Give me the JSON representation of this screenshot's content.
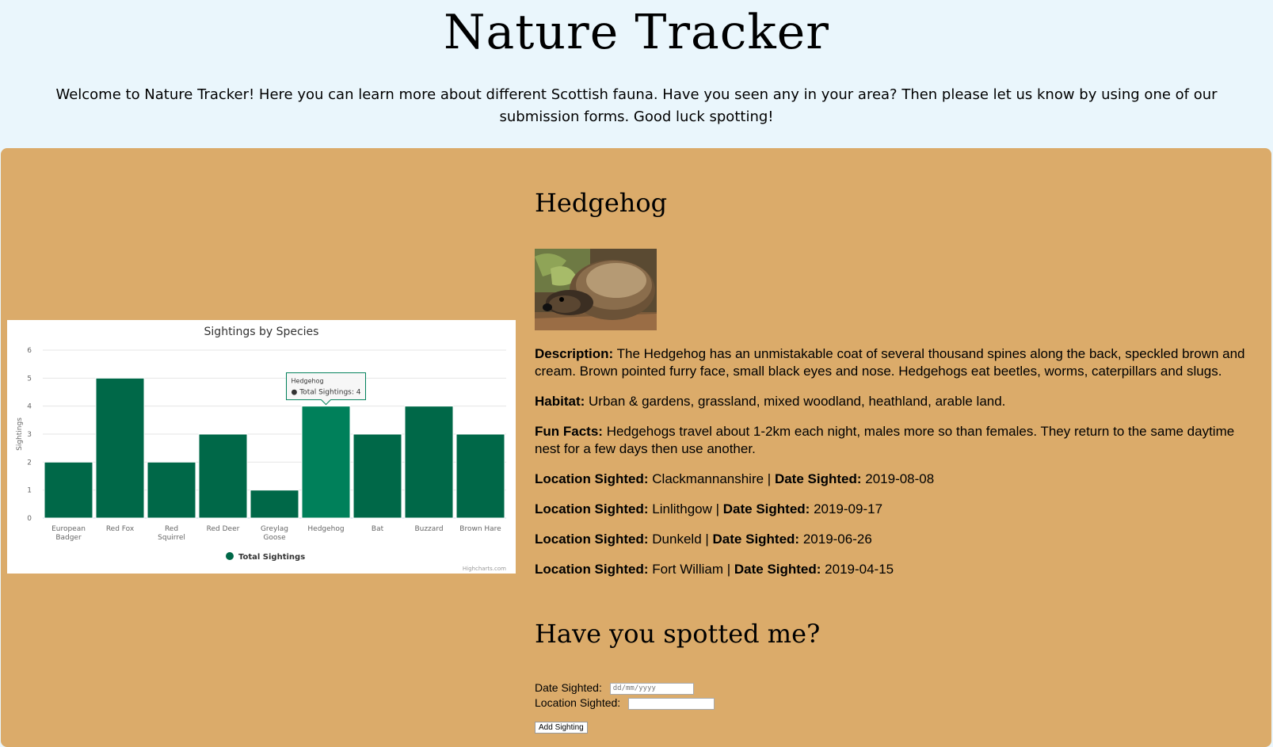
{
  "header": {
    "title": "Nature Tracker",
    "welcome": "Welcome to Nature Tracker! Here you can learn more about different Scottish fauna. Have you seen any in your area? Then please let us know by using one of our submission forms. Good luck spotting!"
  },
  "species": {
    "name": "Hedgehog",
    "description_label": "Description:",
    "description": "The Hedgehog has an unmistakable coat of several thousand spines along the back, speckled brown and cream. Brown pointed furry face, small black eyes and nose. Hedgehogs eat beetles, worms, caterpillars and slugs.",
    "habitat_label": "Habitat:",
    "habitat": "Urban & gardens, grassland, mixed woodland, heathland, arable land.",
    "fun_facts_label": "Fun Facts:",
    "fun_facts": "Hedgehogs travel about 1-2km each night, males more so than females. They return to the same daytime nest for a few days then use another.",
    "location_label": "Location Sighted:",
    "date_label": "Date Sighted:",
    "sightings": [
      {
        "location": "Clackmannanshire",
        "date": "2019-08-08"
      },
      {
        "location": "Linlithgow",
        "date": "2019-09-17"
      },
      {
        "location": "Dunkeld",
        "date": "2019-06-26"
      },
      {
        "location": "Fort William",
        "date": "2019-04-15"
      }
    ]
  },
  "form": {
    "title": "Have you spotted me?",
    "date_label": "Date Sighted:",
    "date_placeholder": "dd/mm/yyyy",
    "location_label": "Location Sighted:",
    "location_value": "",
    "submit_label": "Add Sighting"
  },
  "chart_data": {
    "type": "bar",
    "title": "Sightings by Species",
    "ylabel": "Sightings",
    "xlabel": "",
    "ylim": [
      0,
      6
    ],
    "yticks": [
      0,
      1,
      2,
      3,
      4,
      5,
      6
    ],
    "categories": [
      "European Badger",
      "Red Fox",
      "Red Squirrel",
      "Red Deer",
      "Greylag Goose",
      "Hedgehog",
      "Bat",
      "Buzzard",
      "Brown Hare"
    ],
    "series": [
      {
        "name": "Total Sightings",
        "values": [
          2,
          5,
          2,
          3,
          1,
          4,
          3,
          4,
          3
        ],
        "color": "#006848"
      }
    ],
    "highlight_color": "#00805a",
    "legend_position": "bottom",
    "credit": "Highcharts.com",
    "tooltip": {
      "category": "Hedgehog",
      "series": "Total Sightings",
      "value": "4",
      "text": "Total Sightings: 4"
    }
  },
  "colors": {
    "header_bg": "#eaf6fc",
    "panel_bg": "#dbab6a",
    "bar": "#006848"
  }
}
